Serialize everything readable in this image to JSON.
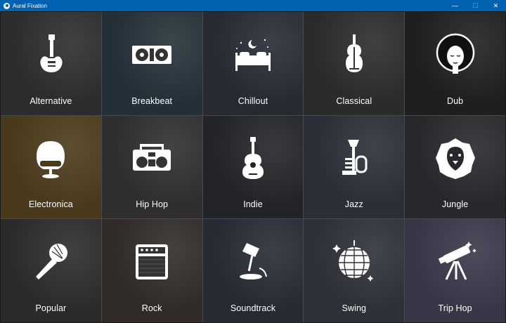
{
  "window": {
    "title": "Aural Fixation",
    "controls": {
      "minimize": "—",
      "maximize": "☐",
      "close": "✕"
    }
  },
  "genres": [
    {
      "label": "Alternative",
      "icon": "electric-guitar-icon",
      "bg": "#2c2c2e"
    },
    {
      "label": "Breakbeat",
      "icon": "turntables-icon",
      "bg": "#243038"
    },
    {
      "label": "Chillout",
      "icon": "bed-night-icon",
      "bg": "#262a33"
    },
    {
      "label": "Classical",
      "icon": "violin-icon",
      "bg": "#2b2b2b"
    },
    {
      "label": "Dub",
      "icon": "afro-face-icon",
      "bg": "#1f1f20"
    },
    {
      "label": "Electronica",
      "icon": "egg-chair-icon",
      "bg": "#4a3a1c"
    },
    {
      "label": "Hip Hop",
      "icon": "boombox-icon",
      "bg": "#2e2e2f"
    },
    {
      "label": "Indie",
      "icon": "acoustic-guitar-icon",
      "bg": "#222428"
    },
    {
      "label": "Jazz",
      "icon": "trumpet-icon",
      "bg": "#2a2e36"
    },
    {
      "label": "Jungle",
      "icon": "lion-icon",
      "bg": "#26282b"
    },
    {
      "label": "Popular",
      "icon": "microphone-icon",
      "bg": "#2b2b2e"
    },
    {
      "label": "Rock",
      "icon": "amplifier-icon",
      "bg": "#302b28"
    },
    {
      "label": "Soundtrack",
      "icon": "spotlight-icon",
      "bg": "#272a33"
    },
    {
      "label": "Swing",
      "icon": "disco-ball-icon",
      "bg": "#2d3036"
    },
    {
      "label": "Trip Hop",
      "icon": "telescope-icon",
      "bg": "#3a3648"
    }
  ]
}
